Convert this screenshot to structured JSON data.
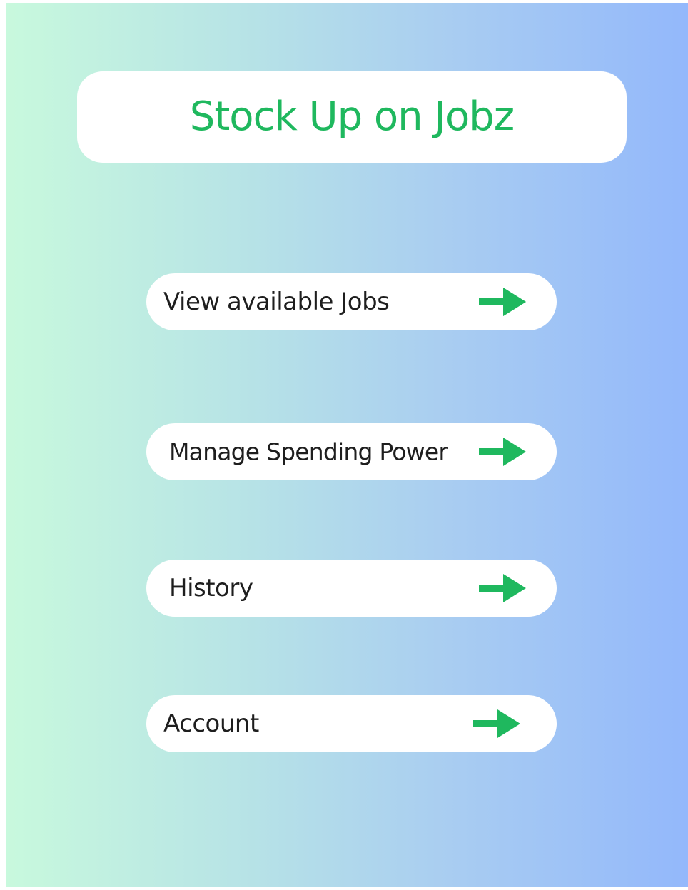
{
  "header": {
    "title": "Stock Up on Jobz"
  },
  "menu": {
    "items": [
      {
        "label": "View available Jobs",
        "icon": "arrow-right-icon"
      },
      {
        "label": "Manage Spending Power",
        "icon": "arrow-right-icon"
      },
      {
        "label": "History",
        "icon": "arrow-right-icon"
      },
      {
        "label": "Account",
        "icon": "arrow-right-icon"
      }
    ]
  },
  "colors": {
    "brand_green": "#1fb85e",
    "text_dark": "#1e1e1e",
    "card_bg": "#ffffff",
    "gradient_start": "#c8f9dd",
    "gradient_end": "#93b8fb"
  }
}
